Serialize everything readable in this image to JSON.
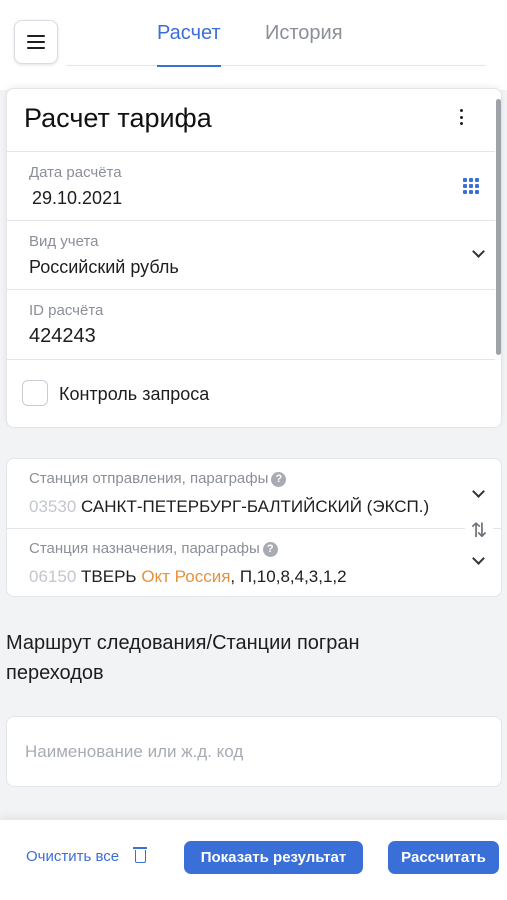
{
  "header": {
    "menu_icon": "hamburger-icon",
    "tabs": [
      {
        "label": "Расчет",
        "active": true
      },
      {
        "label": "История",
        "active": false
      }
    ]
  },
  "form": {
    "title": "Расчет тарифа",
    "calc_date": {
      "label": "Дата расчёта",
      "value": "29.10.2021"
    },
    "account_type": {
      "label": "Вид учета",
      "value": "Российский рубль"
    },
    "calc_id": {
      "label": "ID расчёта",
      "value": "424243"
    },
    "request_control": {
      "label": "Контроль запроса",
      "checked": false
    }
  },
  "stations": {
    "departure": {
      "label": "Станция отправления, параграфы",
      "code": "03530",
      "name": "САНКТ-ПЕТЕРБУРГ-БАЛТИЙСКИЙ (ЭКСП.)"
    },
    "destination": {
      "label": "Станция назначения, параграфы",
      "code": "06150",
      "name": "ТВЕРЬ",
      "railway": "Окт Россия",
      "paragraphs": ", П,10,8,4,3,1,2"
    }
  },
  "route": {
    "title": "Маршрут следования/Станции погран переходов",
    "placeholder": "Наименование или ж.д. код"
  },
  "actions": {
    "clear_all": "Очистить все",
    "show_result": "Показать результат",
    "calculate": "Рассчитать"
  },
  "colors": {
    "accent": "#3b6fd8",
    "railway_highlight": "#e8913a",
    "muted_text": "#8a8f98"
  }
}
